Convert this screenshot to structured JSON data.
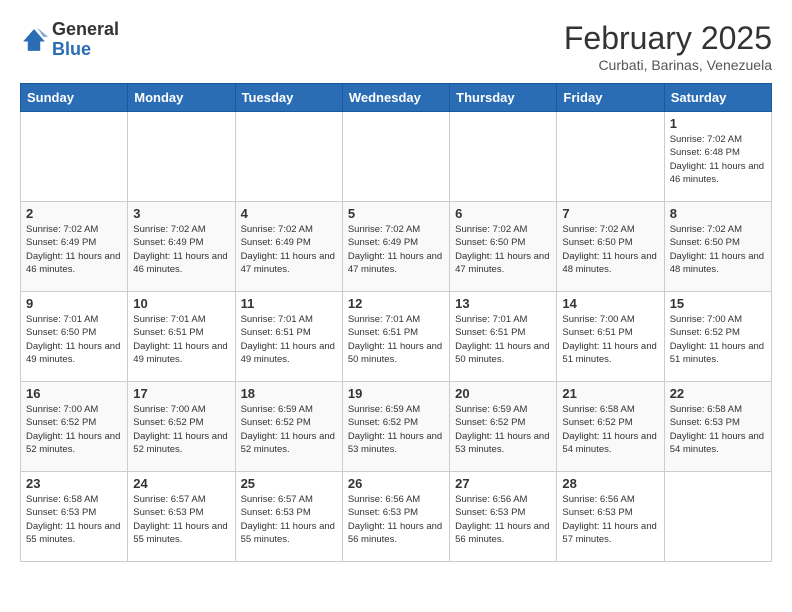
{
  "header": {
    "logo_general": "General",
    "logo_blue": "Blue",
    "month_title": "February 2025",
    "subtitle": "Curbati, Barinas, Venezuela"
  },
  "days_of_week": [
    "Sunday",
    "Monday",
    "Tuesday",
    "Wednesday",
    "Thursday",
    "Friday",
    "Saturday"
  ],
  "weeks": [
    [
      {
        "day": "",
        "info": ""
      },
      {
        "day": "",
        "info": ""
      },
      {
        "day": "",
        "info": ""
      },
      {
        "day": "",
        "info": ""
      },
      {
        "day": "",
        "info": ""
      },
      {
        "day": "",
        "info": ""
      },
      {
        "day": "1",
        "info": "Sunrise: 7:02 AM\nSunset: 6:48 PM\nDaylight: 11 hours and 46 minutes."
      }
    ],
    [
      {
        "day": "2",
        "info": "Sunrise: 7:02 AM\nSunset: 6:49 PM\nDaylight: 11 hours and 46 minutes."
      },
      {
        "day": "3",
        "info": "Sunrise: 7:02 AM\nSunset: 6:49 PM\nDaylight: 11 hours and 46 minutes."
      },
      {
        "day": "4",
        "info": "Sunrise: 7:02 AM\nSunset: 6:49 PM\nDaylight: 11 hours and 47 minutes."
      },
      {
        "day": "5",
        "info": "Sunrise: 7:02 AM\nSunset: 6:49 PM\nDaylight: 11 hours and 47 minutes."
      },
      {
        "day": "6",
        "info": "Sunrise: 7:02 AM\nSunset: 6:50 PM\nDaylight: 11 hours and 47 minutes."
      },
      {
        "day": "7",
        "info": "Sunrise: 7:02 AM\nSunset: 6:50 PM\nDaylight: 11 hours and 48 minutes."
      },
      {
        "day": "8",
        "info": "Sunrise: 7:02 AM\nSunset: 6:50 PM\nDaylight: 11 hours and 48 minutes."
      }
    ],
    [
      {
        "day": "9",
        "info": "Sunrise: 7:01 AM\nSunset: 6:50 PM\nDaylight: 11 hours and 49 minutes."
      },
      {
        "day": "10",
        "info": "Sunrise: 7:01 AM\nSunset: 6:51 PM\nDaylight: 11 hours and 49 minutes."
      },
      {
        "day": "11",
        "info": "Sunrise: 7:01 AM\nSunset: 6:51 PM\nDaylight: 11 hours and 49 minutes."
      },
      {
        "day": "12",
        "info": "Sunrise: 7:01 AM\nSunset: 6:51 PM\nDaylight: 11 hours and 50 minutes."
      },
      {
        "day": "13",
        "info": "Sunrise: 7:01 AM\nSunset: 6:51 PM\nDaylight: 11 hours and 50 minutes."
      },
      {
        "day": "14",
        "info": "Sunrise: 7:00 AM\nSunset: 6:51 PM\nDaylight: 11 hours and 51 minutes."
      },
      {
        "day": "15",
        "info": "Sunrise: 7:00 AM\nSunset: 6:52 PM\nDaylight: 11 hours and 51 minutes."
      }
    ],
    [
      {
        "day": "16",
        "info": "Sunrise: 7:00 AM\nSunset: 6:52 PM\nDaylight: 11 hours and 52 minutes."
      },
      {
        "day": "17",
        "info": "Sunrise: 7:00 AM\nSunset: 6:52 PM\nDaylight: 11 hours and 52 minutes."
      },
      {
        "day": "18",
        "info": "Sunrise: 6:59 AM\nSunset: 6:52 PM\nDaylight: 11 hours and 52 minutes."
      },
      {
        "day": "19",
        "info": "Sunrise: 6:59 AM\nSunset: 6:52 PM\nDaylight: 11 hours and 53 minutes."
      },
      {
        "day": "20",
        "info": "Sunrise: 6:59 AM\nSunset: 6:52 PM\nDaylight: 11 hours and 53 minutes."
      },
      {
        "day": "21",
        "info": "Sunrise: 6:58 AM\nSunset: 6:52 PM\nDaylight: 11 hours and 54 minutes."
      },
      {
        "day": "22",
        "info": "Sunrise: 6:58 AM\nSunset: 6:53 PM\nDaylight: 11 hours and 54 minutes."
      }
    ],
    [
      {
        "day": "23",
        "info": "Sunrise: 6:58 AM\nSunset: 6:53 PM\nDaylight: 11 hours and 55 minutes."
      },
      {
        "day": "24",
        "info": "Sunrise: 6:57 AM\nSunset: 6:53 PM\nDaylight: 11 hours and 55 minutes."
      },
      {
        "day": "25",
        "info": "Sunrise: 6:57 AM\nSunset: 6:53 PM\nDaylight: 11 hours and 55 minutes."
      },
      {
        "day": "26",
        "info": "Sunrise: 6:56 AM\nSunset: 6:53 PM\nDaylight: 11 hours and 56 minutes."
      },
      {
        "day": "27",
        "info": "Sunrise: 6:56 AM\nSunset: 6:53 PM\nDaylight: 11 hours and 56 minutes."
      },
      {
        "day": "28",
        "info": "Sunrise: 6:56 AM\nSunset: 6:53 PM\nDaylight: 11 hours and 57 minutes."
      },
      {
        "day": "",
        "info": ""
      }
    ]
  ]
}
